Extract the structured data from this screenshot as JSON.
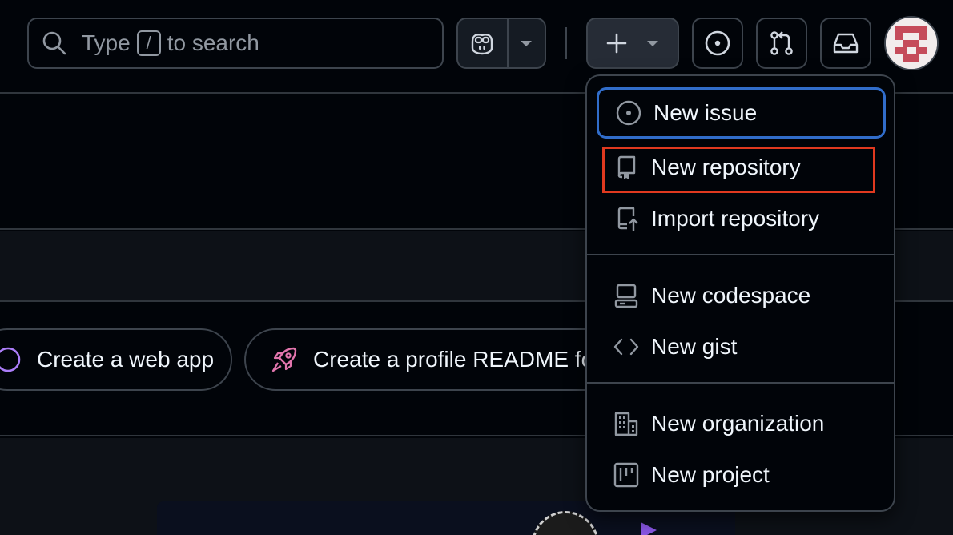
{
  "search": {
    "prefix": "Type",
    "key": "/",
    "suffix": "to search"
  },
  "header": {
    "copilot_icon": "copilot-icon",
    "create_icon": "plus-icon",
    "issues_icon": "issue-opened-icon",
    "pull_requests_icon": "git-pull-request-icon",
    "inbox_icon": "inbox-icon"
  },
  "chips": [
    {
      "icon": "sparkle-circle-icon",
      "label": "Create a web app"
    },
    {
      "icon": "rocket-icon",
      "label": "Create a profile README fo"
    }
  ],
  "create_menu": {
    "groups": [
      [
        {
          "icon": "issue-opened-icon",
          "label": "New issue",
          "focused": true
        },
        {
          "icon": "repo-icon",
          "label": "New repository",
          "highlighted": true
        },
        {
          "icon": "repo-push-icon",
          "label": "Import repository"
        }
      ],
      [
        {
          "icon": "codespaces-icon",
          "label": "New codespace"
        },
        {
          "icon": "code-icon",
          "label": "New gist"
        }
      ],
      [
        {
          "icon": "organization-icon",
          "label": "New organization"
        },
        {
          "icon": "project-icon",
          "label": "New project"
        }
      ]
    ]
  },
  "colors": {
    "background": "#010409",
    "border": "#3d444d",
    "focus_ring": "#316dca",
    "annotation_highlight": "#e0391f",
    "text": "#f0f6fc",
    "muted_text": "#9198a1"
  }
}
